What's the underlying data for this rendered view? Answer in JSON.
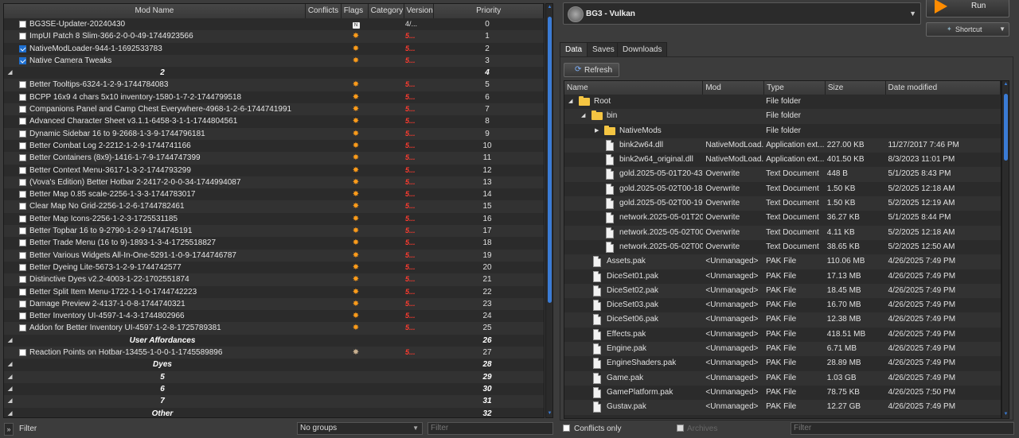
{
  "left": {
    "columns": [
      "Mod Name",
      "Conflicts",
      "Flags",
      "Category",
      "Version",
      "Priority"
    ],
    "rows": [
      {
        "kind": "mod",
        "name": "BG3SE-Updater-20240430",
        "checked": false,
        "flag": "nexus",
        "version": "4/...",
        "priority": "0"
      },
      {
        "kind": "mod",
        "name": "ImpUI Patch 8 Slim-366-2-0-0-49-1744923566",
        "checked": false,
        "flag": "burst",
        "version": "5...",
        "priority": "1"
      },
      {
        "kind": "mod",
        "name": "NativeModLoader-944-1-1692533783",
        "checked": true,
        "flag": "burst",
        "version": "5...",
        "priority": "2"
      },
      {
        "kind": "mod",
        "name": "Native Camera Tweaks",
        "checked": true,
        "flag": "burst",
        "version": "5...",
        "priority": "3"
      },
      {
        "kind": "sep",
        "name": "2",
        "priority": "4"
      },
      {
        "kind": "mod",
        "name": "Better Tooltips-6324-1-2-9-1744784083",
        "checked": false,
        "flag": "burst",
        "version": "5...",
        "priority": "5"
      },
      {
        "kind": "mod",
        "name": "BCPP 16x9 4 chars 5x10 inventory-1580-1-7-2-1744799518",
        "checked": false,
        "flag": "burst",
        "version": "5...",
        "priority": "6"
      },
      {
        "kind": "mod",
        "name": "Companions Panel and Camp Chest Everywhere-4968-1-2-6-1744741991",
        "checked": false,
        "flag": "burst",
        "version": "5...",
        "priority": "7"
      },
      {
        "kind": "mod",
        "name": "Advanced Character Sheet v3.1.1-6458-3-1-1-1744804561",
        "checked": false,
        "flag": "burst",
        "version": "5...",
        "priority": "8"
      },
      {
        "kind": "mod",
        "name": "Dynamic Sidebar 16 to 9-2668-1-3-9-1744796181",
        "checked": false,
        "flag": "burst",
        "version": "5...",
        "priority": "9"
      },
      {
        "kind": "mod",
        "name": "Better Combat Log 2-2212-1-2-9-1744741166",
        "checked": false,
        "flag": "burst",
        "version": "5...",
        "priority": "10"
      },
      {
        "kind": "mod",
        "name": "Better Containers (8x9)-1416-1-7-9-1744747399",
        "checked": false,
        "flag": "burst",
        "version": "5...",
        "priority": "11"
      },
      {
        "kind": "mod",
        "name": "Better Context Menu-3617-1-3-2-1744793299",
        "checked": false,
        "flag": "burst",
        "version": "5...",
        "priority": "12"
      },
      {
        "kind": "mod",
        "name": "(Vova's Edition) Better Hotbar 2-2417-2-0-0-34-1744994087",
        "checked": false,
        "flag": "burst",
        "version": "5...",
        "priority": "13"
      },
      {
        "kind": "mod",
        "name": "Better Map 0.85 scale-2256-1-3-3-1744783017",
        "checked": false,
        "flag": "burst",
        "version": "5...",
        "priority": "14"
      },
      {
        "kind": "mod",
        "name": "Clear Map No Grid-2256-1-2-6-1744782461",
        "checked": false,
        "flag": "burst",
        "version": "5...",
        "priority": "15"
      },
      {
        "kind": "mod",
        "name": "Better Map Icons-2256-1-2-3-1725531185",
        "checked": false,
        "flag": "burst",
        "version": "5...",
        "priority": "16"
      },
      {
        "kind": "mod",
        "name": "Better Topbar 16 to 9-2790-1-2-9-1744745191",
        "checked": false,
        "flag": "burst",
        "version": "5...",
        "priority": "17"
      },
      {
        "kind": "mod",
        "name": "Better Trade Menu (16 to 9)-1893-1-3-4-1725518827",
        "checked": false,
        "flag": "burst",
        "version": "5...",
        "priority": "18"
      },
      {
        "kind": "mod",
        "name": "Better Various Widgets All-In-One-5291-1-0-9-1744746787",
        "checked": false,
        "flag": "burst",
        "version": "5...",
        "priority": "19"
      },
      {
        "kind": "mod",
        "name": "Better Dyeing Lite-5673-1-2-9-1744742577",
        "checked": false,
        "flag": "burst",
        "version": "5...",
        "priority": "20"
      },
      {
        "kind": "mod",
        "name": "Distinctive Dyes v2.2-4003-1-22-1702551874",
        "checked": false,
        "flag": "burst",
        "version": "5...",
        "priority": "21"
      },
      {
        "kind": "mod",
        "name": "Better Split Item Menu-1722-1-1-0-1744742223",
        "checked": false,
        "flag": "burst",
        "version": "5...",
        "priority": "22"
      },
      {
        "kind": "mod",
        "name": "Damage Preview 2-4137-1-0-8-1744740321",
        "checked": false,
        "flag": "burst",
        "version": "5...",
        "priority": "23"
      },
      {
        "kind": "mod",
        "name": "Better Inventory UI-4597-1-4-3-1744802966",
        "checked": false,
        "flag": "burst",
        "version": "5...",
        "priority": "24"
      },
      {
        "kind": "mod",
        "name": "Addon for Better Inventory UI-4597-1-2-8-1725789381",
        "checked": false,
        "flag": "burst",
        "version": "5...",
        "priority": "25"
      },
      {
        "kind": "sep",
        "name": "User Affordances",
        "priority": "26"
      },
      {
        "kind": "mod",
        "name": "Reaction Points on Hotbar-13455-1-0-0-1-1745589896",
        "checked": false,
        "flag": "burst-dim",
        "version": "5...",
        "priority": "27"
      },
      {
        "kind": "sep",
        "name": "Dyes",
        "priority": "28"
      },
      {
        "kind": "sep",
        "name": "5",
        "priority": "29"
      },
      {
        "kind": "sep",
        "name": "6",
        "priority": "30"
      },
      {
        "kind": "sep",
        "name": "7",
        "priority": "31"
      },
      {
        "kind": "sep",
        "name": "Other",
        "priority": "32"
      }
    ],
    "filter_label": "Filter",
    "groups_value": "No groups",
    "filter_placeholder": "Filter"
  },
  "right": {
    "instance": "BG3 - Vulkan",
    "run_label": "Run",
    "shortcut_label": "Shortcut",
    "tabs": [
      "Data",
      "Saves",
      "Downloads"
    ],
    "refresh_label": "Refresh",
    "columns": [
      "Name",
      "Mod",
      "Type",
      "Size",
      "Date modified"
    ],
    "rows": [
      {
        "icon": "folder",
        "level": 0,
        "expander": "open",
        "name": "Root",
        "mod": "",
        "type": "File folder",
        "size": "",
        "date": ""
      },
      {
        "icon": "folder",
        "level": 1,
        "expander": "open",
        "name": "bin",
        "mod": "",
        "type": "File folder",
        "size": "",
        "date": ""
      },
      {
        "icon": "folder",
        "level": 2,
        "expander": "closed",
        "name": "NativeMods",
        "mod": "",
        "type": "File folder",
        "size": "",
        "date": ""
      },
      {
        "icon": "file",
        "level": 2,
        "expander": "",
        "name": "bink2w64.dll",
        "mod": "NativeModLoad...",
        "type": "Application ext...",
        "size": "227.00 KB",
        "date": "11/27/2017 7:46 PM"
      },
      {
        "icon": "file",
        "level": 2,
        "expander": "",
        "name": "bink2w64_original.dll",
        "mod": "NativeModLoad...",
        "type": "Application ext...",
        "size": "401.50 KB",
        "date": "8/3/2023 11:01 PM"
      },
      {
        "icon": "file",
        "level": 2,
        "expander": "",
        "name": "gold.2025-05-01T20-43...",
        "mod": "Overwrite",
        "type": "Text Document",
        "size": "448 B",
        "date": "5/1/2025 8:43 PM"
      },
      {
        "icon": "file",
        "level": 2,
        "expander": "",
        "name": "gold.2025-05-02T00-18...",
        "mod": "Overwrite",
        "type": "Text Document",
        "size": "1.50 KB",
        "date": "5/2/2025 12:18 AM"
      },
      {
        "icon": "file",
        "level": 2,
        "expander": "",
        "name": "gold.2025-05-02T00-19...",
        "mod": "Overwrite",
        "type": "Text Document",
        "size": "1.50 KB",
        "date": "5/2/2025 12:19 AM"
      },
      {
        "icon": "file",
        "level": 2,
        "expander": "",
        "name": "network.2025-05-01T20...",
        "mod": "Overwrite",
        "type": "Text Document",
        "size": "36.27 KB",
        "date": "5/1/2025 8:44 PM"
      },
      {
        "icon": "file",
        "level": 2,
        "expander": "",
        "name": "network.2025-05-02T00...",
        "mod": "Overwrite",
        "type": "Text Document",
        "size": "4.11 KB",
        "date": "5/2/2025 12:18 AM"
      },
      {
        "icon": "file",
        "level": 2,
        "expander": "",
        "name": "network.2025-05-02T00...",
        "mod": "Overwrite",
        "type": "Text Document",
        "size": "38.65 KB",
        "date": "5/2/2025 12:50 AM"
      },
      {
        "icon": "file",
        "level": 1,
        "expander": "",
        "name": "Assets.pak",
        "mod": "<Unmanaged>",
        "type": "PAK File",
        "size": "110.06 MB",
        "date": "4/26/2025 7:49 PM"
      },
      {
        "icon": "file",
        "level": 1,
        "expander": "",
        "name": "DiceSet01.pak",
        "mod": "<Unmanaged>",
        "type": "PAK File",
        "size": "17.13 MB",
        "date": "4/26/2025 7:49 PM"
      },
      {
        "icon": "file",
        "level": 1,
        "expander": "",
        "name": "DiceSet02.pak",
        "mod": "<Unmanaged>",
        "type": "PAK File",
        "size": "18.45 MB",
        "date": "4/26/2025 7:49 PM"
      },
      {
        "icon": "file",
        "level": 1,
        "expander": "",
        "name": "DiceSet03.pak",
        "mod": "<Unmanaged>",
        "type": "PAK File",
        "size": "16.70 MB",
        "date": "4/26/2025 7:49 PM"
      },
      {
        "icon": "file",
        "level": 1,
        "expander": "",
        "name": "DiceSet06.pak",
        "mod": "<Unmanaged>",
        "type": "PAK File",
        "size": "12.38 MB",
        "date": "4/26/2025 7:49 PM"
      },
      {
        "icon": "file",
        "level": 1,
        "expander": "",
        "name": "Effects.pak",
        "mod": "<Unmanaged>",
        "type": "PAK File",
        "size": "418.51 MB",
        "date": "4/26/2025 7:49 PM"
      },
      {
        "icon": "file",
        "level": 1,
        "expander": "",
        "name": "Engine.pak",
        "mod": "<Unmanaged>",
        "type": "PAK File",
        "size": "6.71 MB",
        "date": "4/26/2025 7:49 PM"
      },
      {
        "icon": "file",
        "level": 1,
        "expander": "",
        "name": "EngineShaders.pak",
        "mod": "<Unmanaged>",
        "type": "PAK File",
        "size": "28.89 MB",
        "date": "4/26/2025 7:49 PM"
      },
      {
        "icon": "file",
        "level": 1,
        "expander": "",
        "name": "Game.pak",
        "mod": "<Unmanaged>",
        "type": "PAK File",
        "size": "1.03 GB",
        "date": "4/26/2025 7:49 PM"
      },
      {
        "icon": "file",
        "level": 1,
        "expander": "",
        "name": "GamePlatform.pak",
        "mod": "<Unmanaged>",
        "type": "PAK File",
        "size": "78.75 KB",
        "date": "4/26/2025 7:50 PM"
      },
      {
        "icon": "file",
        "level": 1,
        "expander": "",
        "name": "Gustav.pak",
        "mod": "<Unmanaged>",
        "type": "PAK File",
        "size": "12.27 GB",
        "date": "4/26/2025 7:49 PM"
      }
    ],
    "conflicts_only_label": "Conflicts only",
    "archives_label": "Archives",
    "filter_placeholder": "Filter"
  }
}
